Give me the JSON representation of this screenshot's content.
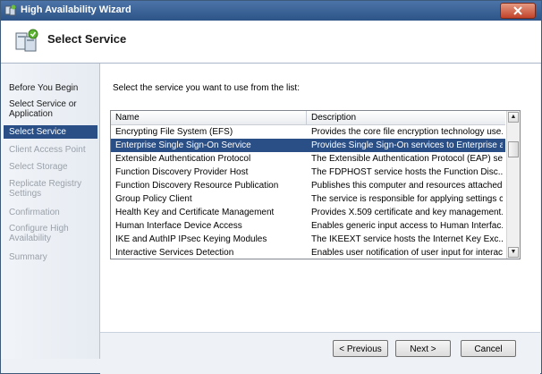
{
  "window": {
    "title": "High Availability Wizard"
  },
  "header": {
    "title": "Select Service"
  },
  "steps": [
    {
      "label": "Before You Begin",
      "state": "normal"
    },
    {
      "label": "Select Service or Application",
      "state": "normal"
    },
    {
      "label": "Select Service",
      "state": "selected"
    },
    {
      "label": "Client Access Point",
      "state": "disabled"
    },
    {
      "label": "Select Storage",
      "state": "disabled"
    },
    {
      "label": "Replicate Registry Settings",
      "state": "disabled"
    },
    {
      "label": "Confirmation",
      "state": "disabled"
    },
    {
      "label": "Configure High Availability",
      "state": "disabled"
    },
    {
      "label": "Summary",
      "state": "disabled"
    }
  ],
  "main": {
    "instruction": "Select the service you want to use from the list:",
    "columns": {
      "name": "Name",
      "description": "Description"
    },
    "rows": [
      {
        "name": "Encrypting File System (EFS)",
        "description": "Provides the core file encryption technology use..."
      },
      {
        "name": "Enterprise Single Sign-On Service",
        "description": "Provides Single Sign-On services to Enterprise a..."
      },
      {
        "name": "Extensible Authentication Protocol",
        "description": "The Extensible Authentication Protocol (EAP) se..."
      },
      {
        "name": "Function Discovery Provider Host",
        "description": "The FDPHOST service hosts the Function Disc..."
      },
      {
        "name": "Function Discovery Resource Publication",
        "description": "Publishes this computer and resources attached..."
      },
      {
        "name": "Group Policy Client",
        "description": "The service is responsible for applying settings c..."
      },
      {
        "name": "Health Key and Certificate Management",
        "description": "Provides X.509 certificate and key management..."
      },
      {
        "name": "Human Interface Device Access",
        "description": "Enables generic input access to Human Interfac..."
      },
      {
        "name": "IKE and AuthIP IPsec Keying Modules",
        "description": "The IKEEXT service hosts the Internet Key Exc..."
      },
      {
        "name": "Interactive Services Detection",
        "description": "Enables user notification of user input for interac..."
      }
    ],
    "selected_index": 1
  },
  "buttons": {
    "previous": "< Previous",
    "next": "Next >",
    "cancel": "Cancel"
  },
  "icons": {
    "close": "close-icon",
    "wizard": "cluster-server-icon"
  }
}
